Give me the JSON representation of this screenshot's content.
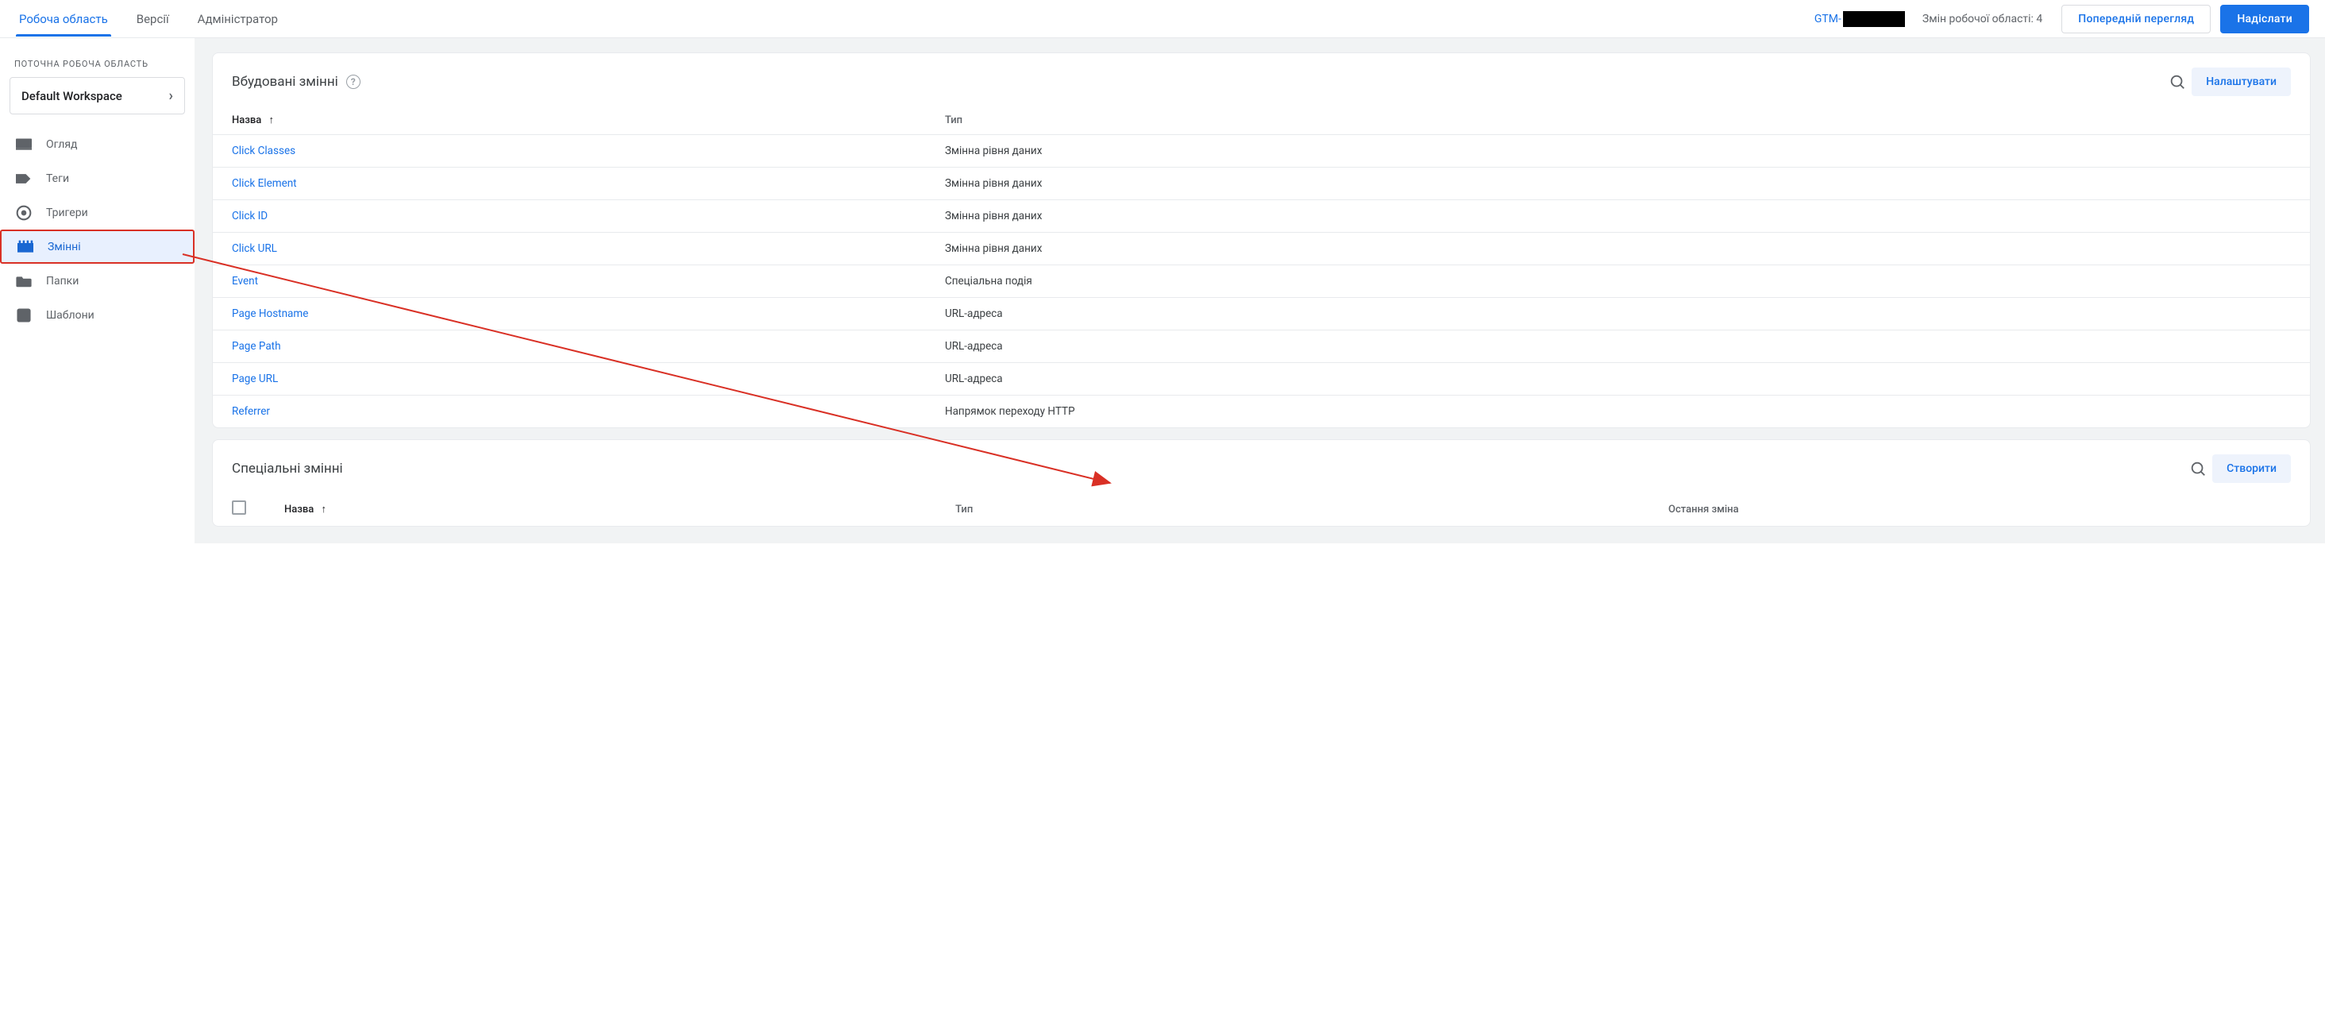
{
  "topnav": {
    "tabs": [
      {
        "label": "Робоча область",
        "active": true
      },
      {
        "label": "Версії",
        "active": false
      },
      {
        "label": "Адміністратор",
        "active": false
      }
    ],
    "gtm_prefix": "GTM-",
    "changes_label": "Змін робочої області: 4",
    "preview_label": "Попередній перегляд",
    "submit_label": "Надіслати"
  },
  "sidebar": {
    "current_ws_label": "ПОТОЧНА РОБОЧА ОБЛАСТЬ",
    "workspace_name": "Default Workspace",
    "items": [
      {
        "label": "Огляд",
        "icon": "overview"
      },
      {
        "label": "Теги",
        "icon": "tag"
      },
      {
        "label": "Тригери",
        "icon": "trigger"
      },
      {
        "label": "Змінні",
        "icon": "variable",
        "active": true,
        "annotated": true
      },
      {
        "label": "Папки",
        "icon": "folder"
      },
      {
        "label": "Шаблони",
        "icon": "template"
      }
    ]
  },
  "builtin": {
    "title": "Вбудовані змінні",
    "configure_label": "Налаштувати",
    "columns": {
      "name": "Назва",
      "type": "Тип"
    },
    "rows": [
      {
        "name": "Click Classes",
        "type": "Змінна рівня даних"
      },
      {
        "name": "Click Element",
        "type": "Змінна рівня даних"
      },
      {
        "name": "Click ID",
        "type": "Змінна рівня даних"
      },
      {
        "name": "Click URL",
        "type": "Змінна рівня даних"
      },
      {
        "name": "Event",
        "type": "Спеціальна подія"
      },
      {
        "name": "Page Hostname",
        "type": "URL-адреса"
      },
      {
        "name": "Page Path",
        "type": "URL-адреса"
      },
      {
        "name": "Page URL",
        "type": "URL-адреса"
      },
      {
        "name": "Referrer",
        "type": "Напрямок переходу HTTP"
      }
    ]
  },
  "custom": {
    "title": "Спеціальні змінні",
    "create_label": "Створити",
    "columns": {
      "name": "Назва",
      "type": "Тип",
      "last_change": "Остання зміна"
    }
  }
}
